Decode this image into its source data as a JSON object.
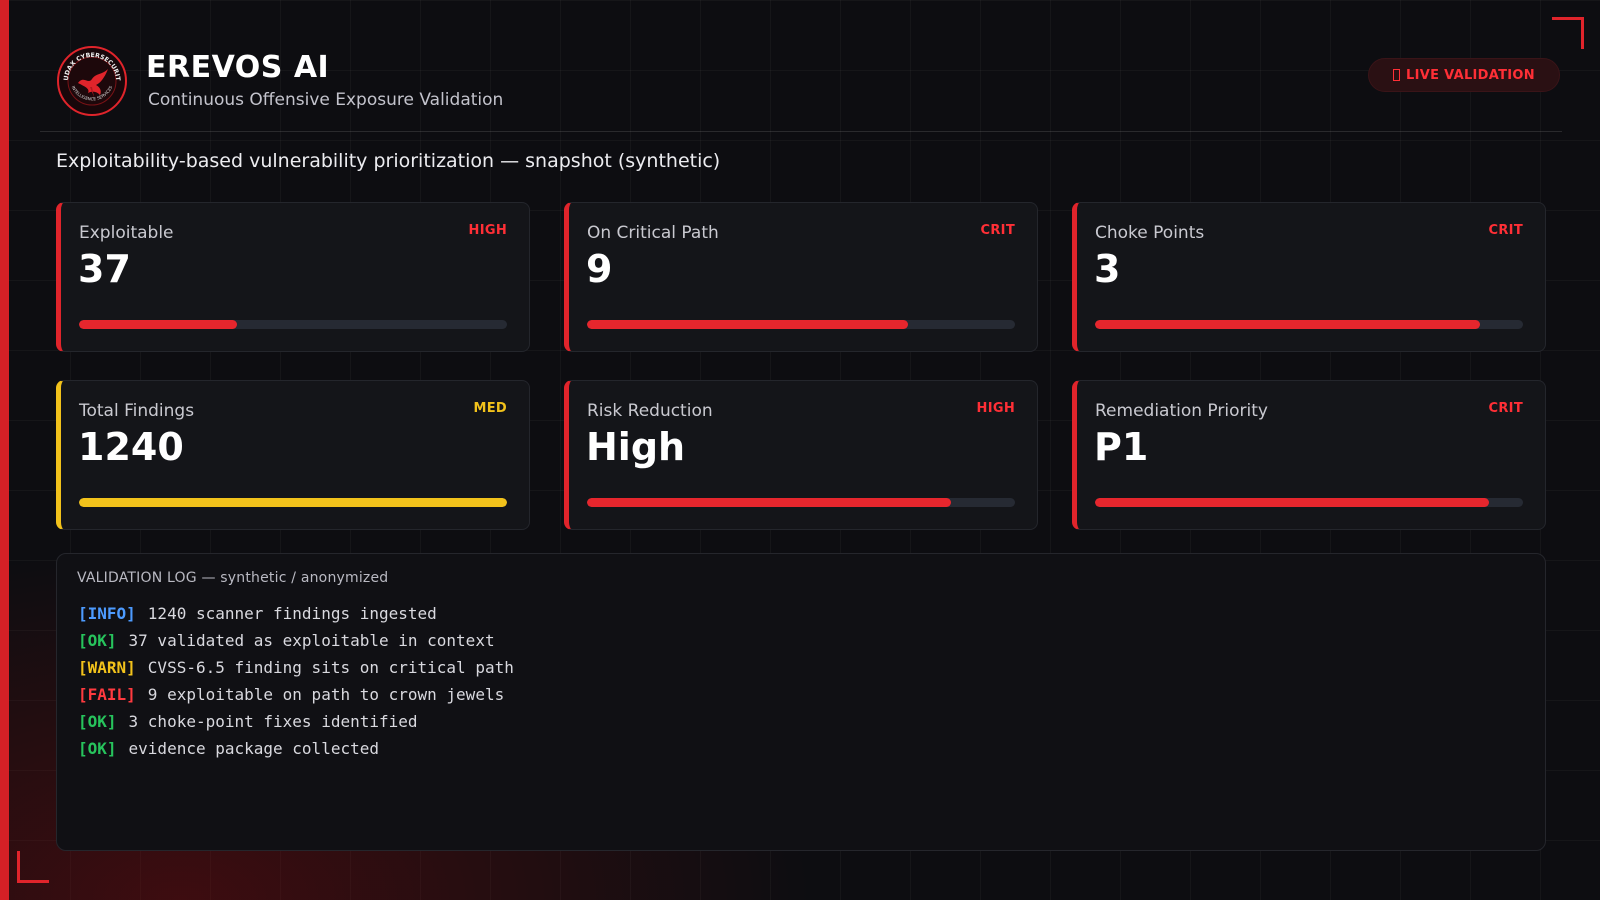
{
  "header": {
    "title": "EREVOS AI",
    "subtitle": "Continuous Offensive Exposure Validation",
    "live_label": "LIVE VALIDATION",
    "logo_text": "AUDAX CYBERSECURITY · INTELLIGENCE SERVICES"
  },
  "page_subtitle": "Exploitability-based vulnerability prioritization — snapshot (synthetic)",
  "cards": [
    {
      "label": "Exploitable",
      "badge": "HIGH",
      "value": "37",
      "progress": 0.37,
      "severity": "high"
    },
    {
      "label": "On Critical Path",
      "badge": "CRIT",
      "value": "9",
      "progress": 0.75,
      "severity": "crit"
    },
    {
      "label": "Choke Points",
      "badge": "CRIT",
      "value": "3",
      "progress": 0.9,
      "severity": "crit"
    },
    {
      "label": "Total Findings",
      "badge": "MED",
      "value": "1240",
      "progress": 1.0,
      "severity": "med"
    },
    {
      "label": "Risk Reduction",
      "badge": "HIGH",
      "value": "High",
      "progress": 0.85,
      "severity": "high"
    },
    {
      "label": "Remediation Priority",
      "badge": "CRIT",
      "value": "P1",
      "progress": 0.92,
      "severity": "crit"
    }
  ],
  "log": {
    "title": "VALIDATION LOG — synthetic / anonymized",
    "lines": [
      {
        "tag": "[INFO]",
        "level": "info",
        "text": "1240 scanner findings ingested"
      },
      {
        "tag": "[OK]",
        "level": "ok",
        "text": "37 validated as exploitable in context"
      },
      {
        "tag": "[WARN]",
        "level": "warn",
        "text": "CVSS-6.5 finding sits on critical path"
      },
      {
        "tag": "[FAIL]",
        "level": "fail",
        "text": "9 exploitable on path to crown jewels"
      },
      {
        "tag": "[OK]",
        "level": "ok",
        "text": "3 choke-point fixes identified"
      },
      {
        "tag": "[OK]",
        "level": "ok",
        "text": "evidence package collected"
      }
    ]
  },
  "colors": {
    "accent_red": "#e0242b",
    "warn_yellow": "#f2c21b",
    "info_blue": "#4d9bff",
    "ok_green": "#27c35c",
    "background": "#0d0d11"
  },
  "icons": {
    "logo": "phoenix-emblem-icon",
    "live": "live-indicator-icon"
  }
}
